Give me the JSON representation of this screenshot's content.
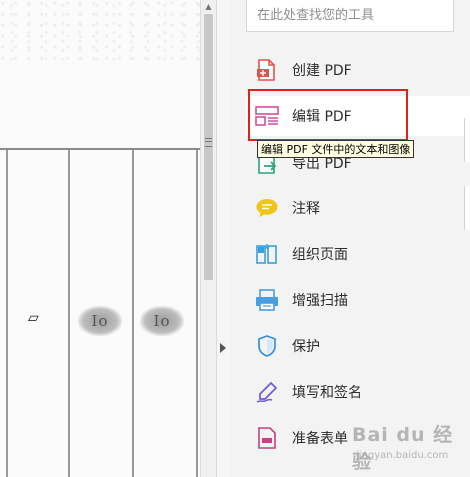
{
  "search": {
    "placeholder": "在此处查找您的工具"
  },
  "tools": [
    {
      "id": "create-pdf",
      "label": "创建 PDF",
      "icon": "create-pdf-icon"
    },
    {
      "id": "edit-pdf",
      "label": "编辑 PDF",
      "icon": "edit-pdf-icon",
      "selected": true
    },
    {
      "id": "export-pdf",
      "label": "导出 PDF",
      "icon": "export-pdf-icon"
    },
    {
      "id": "comment",
      "label": "注释",
      "icon": "comment-icon"
    },
    {
      "id": "organize-pages",
      "label": "组织页面",
      "icon": "organize-pages-icon"
    },
    {
      "id": "enhance-scan",
      "label": "增强扫描",
      "icon": "scan-icon"
    },
    {
      "id": "protect",
      "label": "保护",
      "icon": "shield-icon"
    },
    {
      "id": "fill-sign",
      "label": "填写和签名",
      "icon": "pen-icon"
    },
    {
      "id": "prepare-form",
      "label": "准备表单",
      "icon": "form-icon"
    }
  ],
  "tooltip": {
    "text": "编辑 PDF 文件中的文本和图像"
  },
  "document": {
    "stamp_left": "Io",
    "stamp_right": "Io"
  },
  "watermark": {
    "text": "Bai du 经验",
    "sub": "jingyan.baidu.com"
  },
  "colors": {
    "highlight": "#e0201b",
    "create": "#e1524a",
    "edit": "#d24f9f",
    "export": "#2aa37a",
    "comment": "#f0c419",
    "organize": "#3aa0dd",
    "scan": "#4a9ede",
    "protect": "#3b8fd6",
    "sign": "#6c5dd3",
    "form": "#c8407f"
  }
}
